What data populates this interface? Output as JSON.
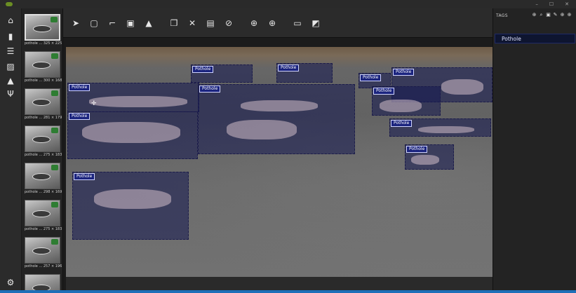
{
  "tags_panel": {
    "header": "TAGS",
    "items": [
      {
        "label": "Pothole"
      }
    ]
  },
  "thumbnails": [
    {
      "caption": "pothole ... 325 × 225",
      "active": true
    },
    {
      "caption": "pothole ... 300 × 168"
    },
    {
      "caption": "pothole ... 281 × 179"
    },
    {
      "caption": "pothole ... 275 × 183"
    },
    {
      "caption": "pothole ... 298 × 169"
    },
    {
      "caption": "pothole ... 275 × 183"
    },
    {
      "caption": "pothole ... 257 × 196"
    },
    {
      "caption": ""
    }
  ],
  "regions": [
    {
      "tag": "Pothole"
    },
    {
      "tag": "Pothole"
    },
    {
      "tag": "Pothole"
    },
    {
      "tag": "Pothole"
    },
    {
      "tag": "Pothole"
    },
    {
      "tag": "Pothole"
    },
    {
      "tag": "Pothole"
    },
    {
      "tag": "Pothole"
    },
    {
      "tag": "Pothole"
    },
    {
      "tag": "Pothole"
    },
    {
      "tag": "Pothole"
    }
  ],
  "icons": {
    "rail": [
      "home-icon",
      "bookmark-icon",
      "sliders-icon",
      "image-icon",
      "graduation-cap-icon",
      "plug-icon",
      "settings-icon"
    ],
    "toolbar": [
      "pointer-icon",
      "rectangle-icon",
      "polygon-icon",
      "copy-rectangle-icon",
      "active-learning-icon",
      "copy-icon",
      "cut-icon",
      "paste-icon",
      "clear-icon",
      "previous-icon",
      "next-icon",
      "save-icon",
      "export-icon"
    ]
  },
  "colors": {
    "region_fill": "#141850",
    "tag_bg": "#1a237e",
    "accent_strip": "#1e6fb8"
  }
}
